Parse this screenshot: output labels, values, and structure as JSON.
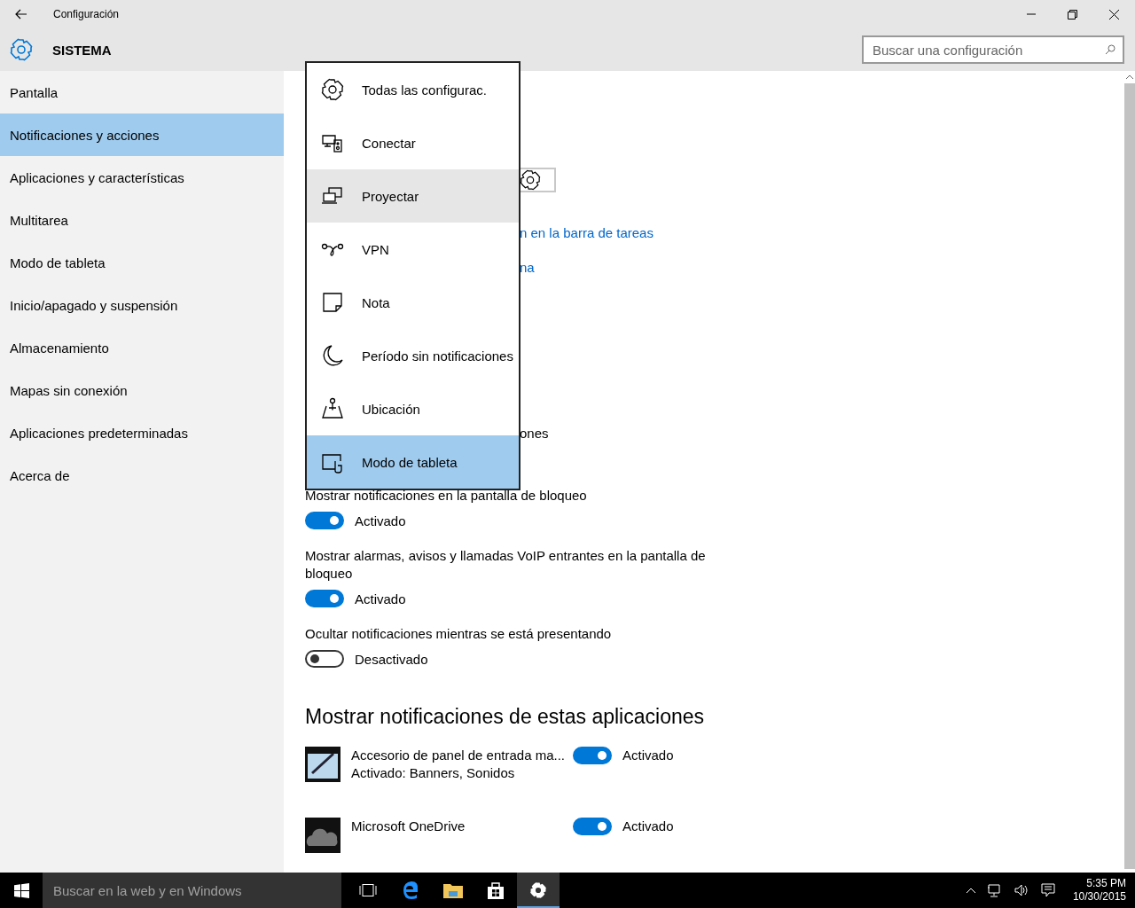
{
  "window": {
    "title": "Configuración"
  },
  "header": {
    "title": "SISTEMA",
    "search": {
      "placeholder": "Buscar una configuración"
    }
  },
  "sidebar": {
    "items": [
      {
        "label": "Pantalla",
        "selected": false
      },
      {
        "label": "Notificaciones y acciones",
        "selected": true
      },
      {
        "label": "Aplicaciones y características",
        "selected": false
      },
      {
        "label": "Multitarea",
        "selected": false
      },
      {
        "label": "Modo de tableta",
        "selected": false
      },
      {
        "label": "Inicio/apagado y suspensión",
        "selected": false
      },
      {
        "label": "Almacenamiento",
        "selected": false
      },
      {
        "label": "Mapas sin conexión",
        "selected": false
      },
      {
        "label": "Aplicaciones predeterminadas",
        "selected": false
      },
      {
        "label": "Acerca de",
        "selected": false
      }
    ]
  },
  "quick_action_menu": {
    "items": [
      {
        "kind": "gear",
        "label": "Todas las configurac.",
        "hovered": false,
        "selected": false
      },
      {
        "kind": "connect",
        "label": "Conectar",
        "hovered": false,
        "selected": false
      },
      {
        "kind": "project",
        "label": "Proyectar",
        "hovered": true,
        "selected": false
      },
      {
        "kind": "vpn",
        "label": "VPN",
        "hovered": false,
        "selected": false
      },
      {
        "kind": "note",
        "label": "Nota",
        "hovered": false,
        "selected": false
      },
      {
        "kind": "moon",
        "label": "Período sin notificaciones",
        "hovered": false,
        "selected": false
      },
      {
        "kind": "location",
        "label": "Ubicación",
        "hovered": false,
        "selected": false
      },
      {
        "kind": "tablet",
        "label": "Modo de tableta",
        "hovered": false,
        "selected": true
      }
    ]
  },
  "partial_texts": {
    "link_1": "n en la barra de tareas",
    "link_2": "na",
    "text_1": "ones"
  },
  "settings": [
    {
      "label": "Mostrar notificaciones en la pantalla de bloqueo",
      "on": true,
      "state": "Activado"
    },
    {
      "label": "Mostrar alarmas, avisos y llamadas VoIP entrantes en la pantalla de bloqueo",
      "on": true,
      "state": "Activado"
    },
    {
      "label": "Ocultar notificaciones mientras se está presentando",
      "on": false,
      "state": "Desactivado"
    }
  ],
  "apps_heading": "Mostrar notificaciones de estas aplicaciones",
  "apps": [
    {
      "kind": "pen",
      "name": "Accesorio de panel de entrada ma...",
      "detail": "Activado: Banners, Sonidos",
      "on": true,
      "state": "Activado"
    },
    {
      "kind": "cloud",
      "name": "Microsoft OneDrive",
      "on": true,
      "state": "Activado"
    }
  ],
  "taskbar": {
    "search": {
      "placeholder": "Buscar en la web y en Windows"
    },
    "time": "5:35 PM",
    "date": "10/30/2015"
  }
}
